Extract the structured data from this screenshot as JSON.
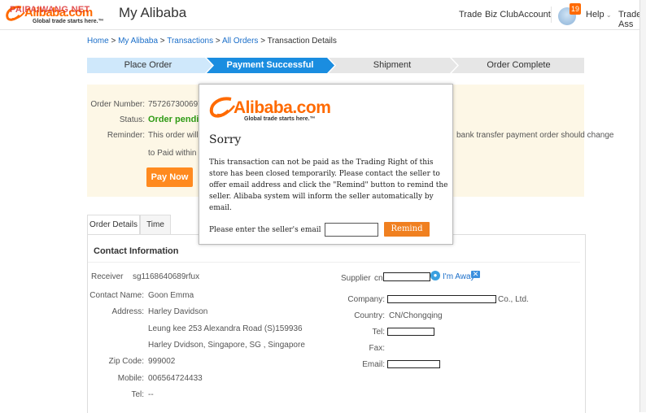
{
  "header": {
    "logo_text": "Alibaba.com",
    "logo_tagline": "Global trade starts here.™",
    "watermark": "PAIPAIWANG.NET",
    "page_title": "My Alibaba",
    "nav": [
      "Trade",
      "Biz Club",
      "Account"
    ],
    "notification_count": "19",
    "help": "Help",
    "trade_assurance": "Trade Ass"
  },
  "breadcrumb": {
    "home": "Home",
    "my_alibaba": "My Alibaba",
    "transactions": "Transactions",
    "all_orders": "All Orders",
    "current": "Transaction Details",
    "sep": " > "
  },
  "steps": [
    {
      "label": "Place Order",
      "state": "done"
    },
    {
      "label": "Payment Successful",
      "state": "active"
    },
    {
      "label": "Shipment",
      "state": "todo"
    },
    {
      "label": "Order Complete",
      "state": "todo"
    }
  ],
  "order": {
    "number_label": "Order Number:",
    "number_value": "75726730069772",
    "status_label": "Status:",
    "status_value": "Order pending y",
    "reminder_label": "Reminder:",
    "reminder_line1": "This order will be c",
    "reminder_line1_right": "bank transfer payment order should change",
    "reminder_line2": "to Paid within 7 w",
    "pay_now": "Pay Now"
  },
  "tabs": [
    "Order Details",
    "Time"
  ],
  "details": {
    "section_title": "Contact Information",
    "receiver_label": "Receiver",
    "receiver_value": "sg1168640689rfux",
    "contact_name_label": "Contact Name:",
    "contact_name_value": "Goon Emma",
    "address_label": "Address:",
    "address_line1": "Harley Davidson",
    "address_line2": "Leung kee 253 Alexandra Road (S)159936",
    "address_line3": "Harley Dvidson, Singapore, SG , Singapore",
    "zip_label": "Zip Code:",
    "zip_value": "999002",
    "mobile_label": "Mobile:",
    "mobile_value": "006564724433",
    "tel_label": "Tel:",
    "tel_value": "--",
    "supplier_label": "Supplier",
    "supplier_prefix": "cn",
    "im_away": "I'm Away",
    "company_label": "Company:",
    "company_suffix": "Co., Ltd.",
    "country_label": "Country:",
    "country_value": "CN/Chongqing",
    "s_tel_label": "Tel:",
    "fax_label": "Fax:",
    "email_label": "Email:"
  },
  "modal": {
    "logo_text": "Alibaba.com",
    "logo_tagline": "Global trade starts here.™",
    "title": "Sorry",
    "message_line1": "This transaction can not be paid as the Trading Right of this",
    "message_line2": "store has been closed temporarily. Please contact the seller to",
    "message_line3": "offer email address and click the \"Remind\" button to remind the",
    "message_line4": "seller. Alibaba system will inform the seller automatically by",
    "message_line5": "email.",
    "email_prompt": "Please enter the seller's email",
    "remind_button": "Remind"
  },
  "colors": {
    "accent": "#ff6a00",
    "step_active": "#1a8de0",
    "step_done": "#cfe8fb",
    "step_todo": "#e6e6e6",
    "panel_bg": "#fdf7e6",
    "status_green": "#2e9b15"
  }
}
